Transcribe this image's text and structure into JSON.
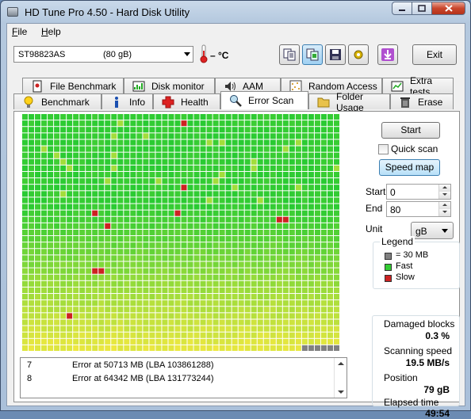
{
  "window": {
    "title": "HD Tune Pro 4.50 - Hard Disk Utility"
  },
  "menu": {
    "items": [
      {
        "label": "File",
        "hotkey": "F",
        "rest": "ile"
      },
      {
        "label": "Help",
        "hotkey": "H",
        "rest": "elp"
      }
    ]
  },
  "toolbar": {
    "drive_name": "ST98823AS",
    "drive_size": "(80 gB)",
    "temperature": "– °C",
    "exit_label": "Exit",
    "icons": [
      "copy-info-icon",
      "copy-screenshot-icon",
      "save-icon",
      "options-icon",
      "download-icon"
    ]
  },
  "tabs": {
    "row1": [
      {
        "label": "File Benchmark",
        "icon": "file-benchmark-icon"
      },
      {
        "label": "Disk monitor",
        "icon": "disk-monitor-icon"
      },
      {
        "label": "AAM",
        "icon": "speaker-icon"
      },
      {
        "label": "Random Access",
        "icon": "random-access-icon"
      },
      {
        "label": "Extra tests",
        "icon": "extra-tests-icon"
      }
    ],
    "row2": [
      {
        "label": "Benchmark",
        "icon": "lightbulb-icon"
      },
      {
        "label": "Info",
        "icon": "info-icon"
      },
      {
        "label": "Health",
        "icon": "health-cross-icon"
      },
      {
        "label": "Error Scan",
        "icon": "magnifier-icon",
        "selected": true
      },
      {
        "label": "Folder Usage",
        "icon": "folder-icon"
      },
      {
        "label": "Erase",
        "icon": "trash-icon"
      }
    ]
  },
  "controls": {
    "start_button": "Start",
    "quick_scan_label": "Quick scan",
    "quick_scan_checked": false,
    "speed_map_button": "Speed map",
    "start_label": "Start",
    "start_value": "0",
    "end_label": "End",
    "end_value": "80",
    "unit_label": "Unit",
    "unit_value": "gB"
  },
  "legend": {
    "title": "Legend",
    "items": [
      {
        "label": "= 30 MB",
        "color": "#808080"
      },
      {
        "label": "Fast",
        "color": "#33cc33"
      },
      {
        "label": "Slow",
        "color": "#cc2222"
      }
    ]
  },
  "stats": {
    "damaged_label": "Damaged blocks",
    "damaged_value": "0.3 %",
    "speed_label": "Scanning speed",
    "speed_value": "19.5 MB/s",
    "position_label": "Position",
    "position_value": "79 gB",
    "elapsed_label": "Elapsed time",
    "elapsed_value": "49:54"
  },
  "log": {
    "rows": [
      {
        "num": "7",
        "msg": "Error at 50713 MB (LBA 103861288)"
      },
      {
        "num": "8",
        "msg": "Error at 64342 MB (LBA 131773244)"
      }
    ]
  },
  "map": {
    "cols": 50,
    "rows": 37,
    "colors": {
      "fast": "#33cc33",
      "slow": "#cc2222",
      "unscanned": "#808080",
      "mid": "#e0e040",
      "grid": "#2b6b2b"
    },
    "red_cells": [
      [
        1,
        25
      ],
      [
        11,
        25
      ],
      [
        15,
        11
      ],
      [
        15,
        24
      ],
      [
        17,
        13
      ],
      [
        16,
        40
      ],
      [
        16,
        41
      ],
      [
        24,
        11
      ],
      [
        24,
        12
      ],
      [
        31,
        7
      ]
    ],
    "unscanned_tail": 6
  }
}
